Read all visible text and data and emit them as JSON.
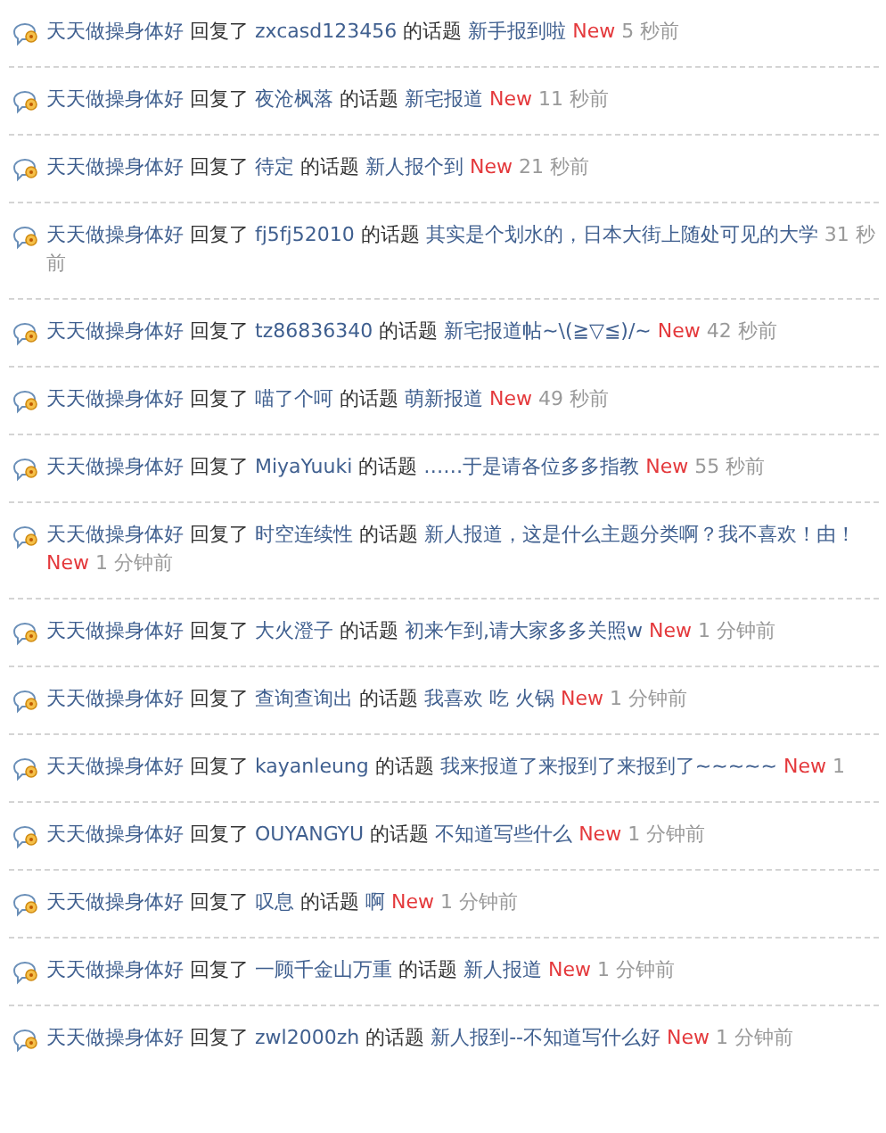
{
  "activities": [
    {
      "actor": "天天做操身体好",
      "verb": "回复了",
      "user": "zxcasd123456",
      "of_topic": "的话题",
      "topic": "新手报到啦",
      "new_label": "New",
      "time": "5 秒前"
    },
    {
      "actor": "天天做操身体好",
      "verb": "回复了",
      "user": "夜沧枫落",
      "of_topic": "的话题",
      "topic": "新宅报道",
      "new_label": "New",
      "time": "11 秒前"
    },
    {
      "actor": "天天做操身体好",
      "verb": "回复了",
      "user": "待定",
      "of_topic": "的话题",
      "topic": "新人报个到",
      "new_label": "New",
      "time": "21 秒前"
    },
    {
      "actor": "天天做操身体好",
      "verb": "回复了",
      "user": "fj5fj52010",
      "of_topic": "的话题",
      "topic": "其实是个划水的，日本大街上随处可见的大学",
      "time": "31 秒前"
    },
    {
      "actor": "天天做操身体好",
      "verb": "回复了",
      "user": "tz86836340",
      "of_topic": "的话题",
      "topic": "新宅报道帖~\\(≧▽≦)/~",
      "new_label": "New",
      "time": "42 秒前"
    },
    {
      "actor": "天天做操身体好",
      "verb": "回复了",
      "user": "喵了个呵",
      "of_topic": "的话题",
      "topic": "萌新报道",
      "new_label": "New",
      "time": "49 秒前"
    },
    {
      "actor": "天天做操身体好",
      "verb": "回复了",
      "user": "MiyaYuuki",
      "of_topic": "的话题",
      "topic": "……于是请各位多多指教",
      "new_label": "New",
      "time": "55 秒前"
    },
    {
      "actor": "天天做操身体好",
      "verb": "回复了",
      "user": "时空连续性",
      "of_topic": "的话题",
      "topic": "新人报道，这是什么主题分类啊？我不喜欢！由！",
      "new_label": "New",
      "time": "1 分钟前"
    },
    {
      "actor": "天天做操身体好",
      "verb": "回复了",
      "user": "大火澄子",
      "of_topic": "的话题",
      "topic": "初来乍到,请大家多多关照w",
      "new_label": "New",
      "time": "1 分钟前"
    },
    {
      "actor": "天天做操身体好",
      "verb": "回复了",
      "user": "查询查询出",
      "of_topic": "的话题",
      "topic": "我喜欢 吃 火锅",
      "new_label": "New",
      "time": "1 分钟前"
    },
    {
      "actor": "天天做操身体好",
      "verb": "回复了",
      "user": "kayanleung",
      "of_topic": "的话题",
      "topic": "我来报道了来报到了来报到了~~~~~",
      "new_label": "New",
      "time": "1"
    },
    {
      "actor": "天天做操身体好",
      "verb": "回复了",
      "user": "OUYANGYU",
      "of_topic": "的话题",
      "topic": "不知道写些什么",
      "new_label": "New",
      "time": "1 分钟前"
    },
    {
      "actor": "天天做操身体好",
      "verb": "回复了",
      "user": "叹息",
      "of_topic": "的话题",
      "topic": "啊",
      "new_label": "New",
      "time": "1 分钟前"
    },
    {
      "actor": "天天做操身体好",
      "verb": "回复了",
      "user": "一顾千金山万重",
      "of_topic": "的话题",
      "topic": "新人报道",
      "new_label": "New",
      "time": "1 分钟前"
    },
    {
      "actor": "天天做操身体好",
      "verb": "回复了",
      "user": "zwl2000zh",
      "of_topic": "的话题",
      "topic": "新人报到--不知道写什么好",
      "new_label": "New",
      "time": "1 分钟前"
    }
  ]
}
